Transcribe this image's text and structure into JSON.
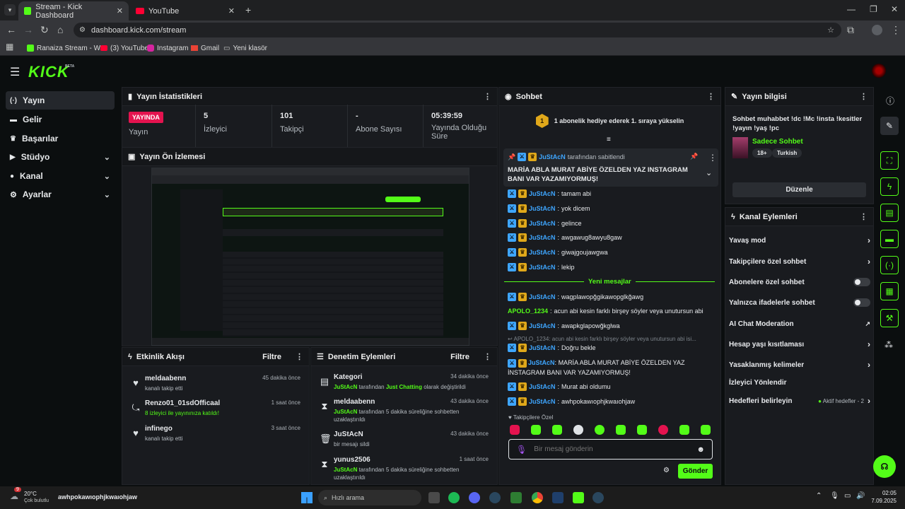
{
  "browser": {
    "tabs": [
      {
        "title": "Stream - Kick Dashboard",
        "active": true
      },
      {
        "title": "YouTube",
        "active": false
      }
    ],
    "url": "dashboard.kick.com/stream",
    "bookmarks": [
      "Ranaiza Stream - W...",
      "(3) YouTube",
      "Instagram",
      "Gmail",
      "Yeni klasör"
    ]
  },
  "brand": {
    "logo": "KICK",
    "beta": "BETA",
    "accent": "#53fc18"
  },
  "sidebar": {
    "items": [
      {
        "label": "Yayın",
        "icon": "broadcast-icon",
        "active": true,
        "expandable": false
      },
      {
        "label": "Gelir",
        "icon": "money-icon",
        "active": false,
        "expandable": false
      },
      {
        "label": "Başarılar",
        "icon": "trophy-icon",
        "active": false,
        "expandable": false
      },
      {
        "label": "Stüdyo",
        "icon": "video-icon",
        "active": false,
        "expandable": true
      },
      {
        "label": "Kanal",
        "icon": "person-icon",
        "active": false,
        "expandable": true
      },
      {
        "label": "Ayarlar",
        "icon": "gear-icon",
        "active": false,
        "expandable": true
      }
    ]
  },
  "stats": {
    "title": "Yayın İstatistikleri",
    "live_badge": "YAYINDA",
    "live_label": "Yayın",
    "viewers": {
      "value": "5",
      "label": "İzleyici"
    },
    "followers": {
      "value": "101",
      "label": "Takipçi"
    },
    "subs": {
      "value": "-",
      "label": "Abone Sayısı"
    },
    "uptime": {
      "value": "05:39:59",
      "label": "Yayında Olduğu Süre"
    }
  },
  "preview": {
    "title": "Yayın Ön İzlemesi"
  },
  "activity": {
    "title": "Etkinlik Akışı",
    "filter": "Filtre",
    "items": [
      {
        "icon": "heart-icon",
        "name": "meldaabenn",
        "desc": "kanalı takip etti",
        "time": "45 dakika önce",
        "desc_green": false
      },
      {
        "icon": "raid-icon",
        "name": "Renzo01_01sdOfficaal",
        "desc": "8 izleyici ile yayınınıza katıldı!",
        "time": "1 saat önce",
        "desc_green": false
      },
      {
        "icon": "heart-icon",
        "name": "infinego",
        "desc": "kanalı takip etti",
        "time": "3 saat önce",
        "desc_green": false
      }
    ]
  },
  "moderation": {
    "title": "Denetim Eylemleri",
    "filter": "Filtre",
    "items": [
      {
        "icon": "category-icon",
        "name": "Kategori",
        "actor": "JuStAcN",
        "desc": "tarafından",
        "extra": "Just Chatting",
        "desc2": "olarak değiştirildi",
        "time": "34 dakika önce"
      },
      {
        "icon": "hourglass-icon",
        "name": "meldaabenn",
        "actor": "JuStAcN",
        "desc": "tarafından 5 dakika süreliğine sohbetten uzaklaştırıldı",
        "extra": "",
        "desc2": "",
        "time": "43 dakika önce"
      },
      {
        "icon": "trash-icon",
        "name": "JuStAcN",
        "actor": "",
        "desc": "bir mesajı sildi",
        "extra": "",
        "desc2": "",
        "time": "43 dakika önce"
      },
      {
        "icon": "hourglass-icon",
        "name": "yunus2506",
        "actor": "JuStAcN",
        "desc": "tarafından 5 dakika süreliğine sohbetten uzaklaştırıldı",
        "extra": "",
        "desc2": "",
        "time": "1 saat önce"
      }
    ]
  },
  "chat": {
    "title": "Sohbet",
    "gift_banner": {
      "number": "1",
      "text": "1 abonelik hediye ederek 1. sıraya yükselin"
    },
    "pinned": {
      "by": "JuStAcN",
      "by_suffix": "tarafından sabitlendi",
      "message": "MARİA ABLA MURAT ABİYE ÖZELDEN YAZ INSTAGRAM BANI VAR YAZAMIYORMUŞ!"
    },
    "messages_before": [
      {
        "user": "JuStAcN",
        "text": "tamam abi"
      },
      {
        "user": "JuStAcN",
        "text": "yok dicem"
      },
      {
        "user": "JuStAcN",
        "text": "gelince"
      },
      {
        "user": "JuStAcN",
        "text": "awgawug8awyu8gaw"
      },
      {
        "user": "JuStAcN",
        "text": "giwajgoujawgwa"
      },
      {
        "user": "JuStAcN",
        "text": "lekip"
      }
    ],
    "new_messages_label": "Yeni mesajlar",
    "messages_after": [
      {
        "user": "JuStAcN",
        "text": "wagplawopğgikawopglkğawg",
        "badges": true,
        "green": false
      },
      {
        "user": "APOLO_1234",
        "text": "acun abi kesin farklı birşey söyler veya unutursun abi",
        "badges": false,
        "green": true
      },
      {
        "user": "JuStAcN",
        "text": "awapkglapowğkglwa",
        "badges": true,
        "green": false
      }
    ],
    "reply_ref": "APOLO_1234: acun abi kesin farklı birşey söyler veya unutursun abi isi...",
    "messages_after2": [
      {
        "user": "JuStAcN",
        "text": "Doğru bekle"
      },
      {
        "user": "JuStAcN",
        "text": "MARİA ABLA MURAT ABİYE ÖZELDEN YAZ İNSTAGRAM BANI VAR YAZAMIYORMUŞ!"
      },
      {
        "user": "JuStAcN",
        "text": "Murat abi oldumu"
      },
      {
        "user": "JuStAcN",
        "text": "awhpokawıophjkwaıohjaw"
      }
    ],
    "followers_only": "Takipçilere Özel",
    "input_placeholder": "Bir mesaj gönderin",
    "send_button": "Gönder"
  },
  "stream_info": {
    "title": "Yayın bilgisi",
    "stream_title": "Sohbet muhabbet !dc !Mc !insta !kesitler !yayın !yaş !pc",
    "category": "Sadece Sohbet",
    "tags": [
      "18+",
      "Turkish"
    ],
    "edit_button": "Düzenle"
  },
  "channel_actions": {
    "title": "Kanal Eylemleri",
    "rows": [
      {
        "label": "Yavaş mod",
        "control": "arrow"
      },
      {
        "label": "Takipçilere özel sohbet",
        "control": "arrow"
      },
      {
        "label": "Abonelere özel sohbet",
        "control": "toggle"
      },
      {
        "label": "Yalnızca ifadelerle sohbet",
        "control": "toggle"
      },
      {
        "label": "AI Chat Moderation",
        "control": "external"
      },
      {
        "label": "Hesap yaşı kısıtlaması",
        "control": "arrow"
      },
      {
        "label": "Yasaklanmış kelimeler",
        "control": "arrow"
      },
      {
        "label": "İzleyici Yönlendir",
        "control": "none"
      },
      {
        "label": "Hedefleri belirleyin",
        "control": "goals",
        "note": "Aktif hedefler - 2"
      }
    ]
  },
  "taskbar": {
    "weather_temp": "20°C",
    "weather_desc": "Çok bulutlu",
    "notification": "9",
    "ticker": "awhpokawıophjkwaıohjaw",
    "search": "Hızlı arama",
    "time": "02:05",
    "date": "7.09.2025"
  }
}
